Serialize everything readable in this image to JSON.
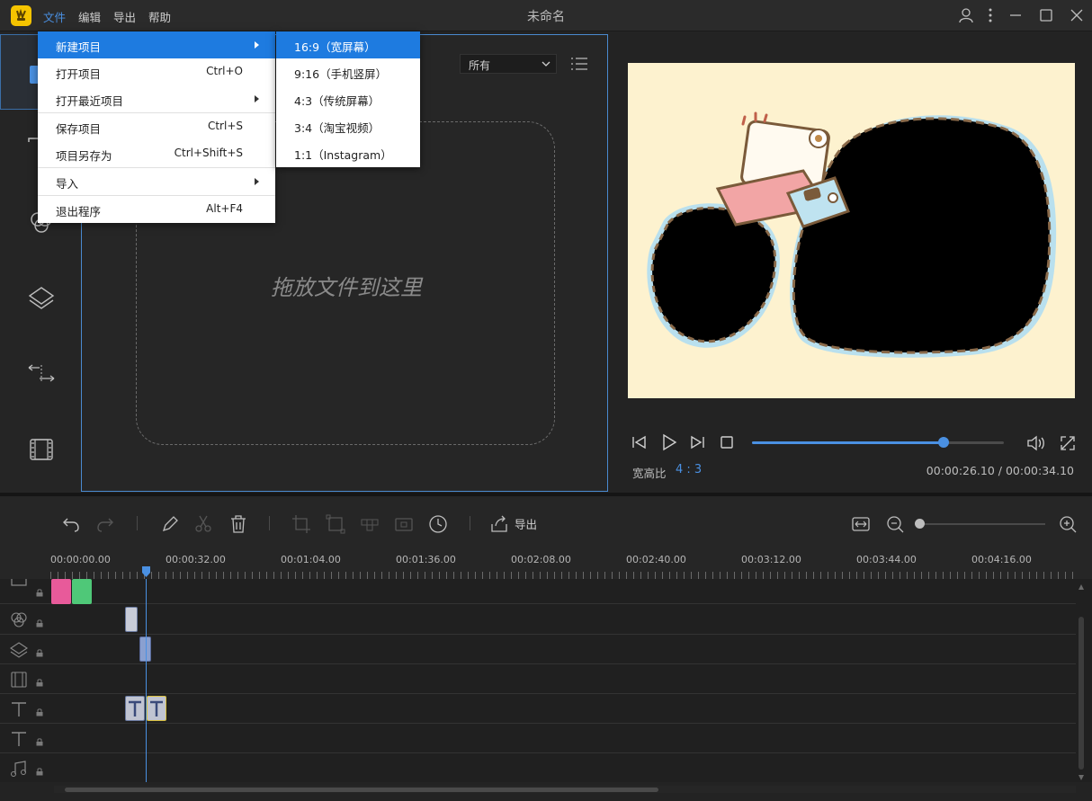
{
  "app": {
    "title": "未命名"
  },
  "menubar": {
    "items": [
      "文件",
      "编辑",
      "导出",
      "帮助"
    ]
  },
  "file_menu": {
    "items": [
      {
        "label": "新建项目",
        "shortcut": "",
        "submenu": true
      },
      {
        "label": "打开项目",
        "shortcut": "Ctrl+O",
        "submenu": false
      },
      {
        "label": "打开最近项目",
        "shortcut": "",
        "submenu": true
      },
      {
        "label": "保存项目",
        "shortcut": "Ctrl+S",
        "submenu": false
      },
      {
        "label": "项目另存为",
        "shortcut": "Ctrl+Shift+S",
        "submenu": false
      },
      {
        "label": "导入",
        "shortcut": "",
        "submenu": true
      },
      {
        "label": "退出程序",
        "shortcut": "Alt+F4",
        "submenu": false
      }
    ]
  },
  "new_project_submenu": {
    "items": [
      "16:9（宽屏幕）",
      "9:16（手机竖屏）",
      "4:3（传统屏幕）",
      "3:4（淘宝视频）",
      "1:1（Instagram）"
    ]
  },
  "media": {
    "filter_value": "所有",
    "drop_text": "拖放文件到这里"
  },
  "preview": {
    "ratio_label": "宽高比",
    "ratio_value": "4 : 3",
    "timecode": "00:00:26.10 / 00:00:34.10",
    "progress": 0.76
  },
  "toolbar": {
    "export_label": "导出",
    "zoom": 0.0
  },
  "timeline": {
    "ruler_labels": [
      "00:00:00.00",
      "00:00:32.00",
      "00:01:04.00",
      "00:01:36.00",
      "00:02:08.00",
      "00:02:40.00",
      "00:03:12.00",
      "00:03:44.00",
      "00:04:16.00"
    ]
  },
  "colors": {
    "accent": "#1e7be0",
    "progress": "#4a90e2",
    "canvas_bg": "#fdf2cf"
  }
}
